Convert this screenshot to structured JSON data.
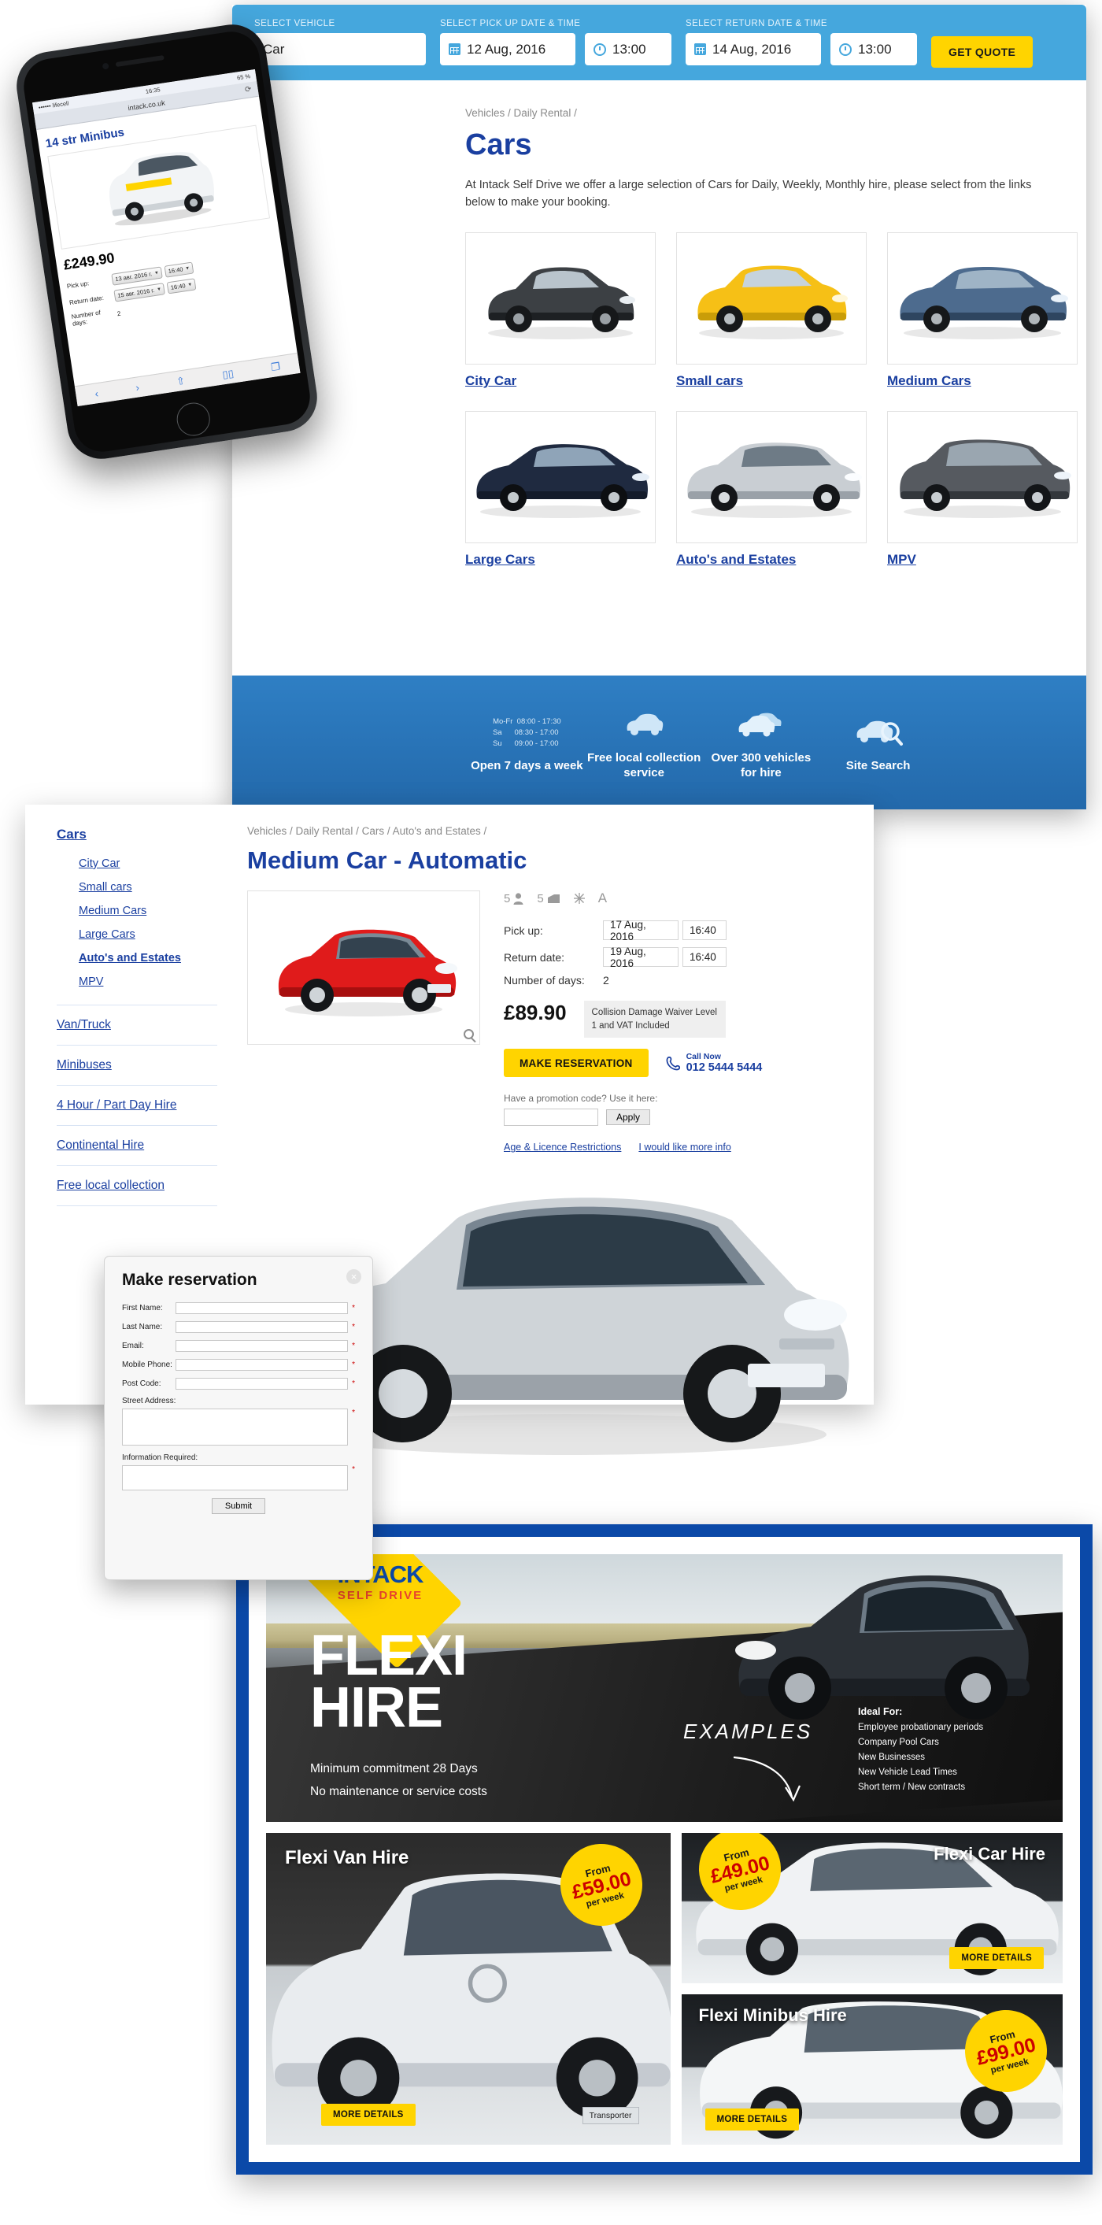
{
  "quote_bar": {
    "vehicle_label": "SELECT VEHICLE",
    "vehicle_value": "Car",
    "pickup_label": "SELECT PICK UP DATE & TIME",
    "pickup_date": "12 Aug, 2016",
    "pickup_time": "13:00",
    "return_label": "SELECT RETURN DATE & TIME",
    "return_date": "14 Aug, 2016",
    "return_time": "13:00",
    "get_quote": "GET QUOTE",
    "accent": "#45a7dd",
    "button_color": "#ffd400"
  },
  "cars_page": {
    "breadcrumb": "Vehicles / Daily Rental /",
    "title": "Cars",
    "intro": "At Intack Self Drive we offer a large selection of Cars for Daily, Weekly, Monthly hire, please select from the links below to make your booking.",
    "tiles": [
      {
        "label": "City Car"
      },
      {
        "label": "Small cars"
      },
      {
        "label": "Medium Cars"
      },
      {
        "label": "Large Cars"
      },
      {
        "label": "Auto's and Estates"
      },
      {
        "label": "MPV"
      }
    ],
    "features": [
      {
        "icon": "clock-icon",
        "title": "Open 7 days a week",
        "hours": "Mo-Fr  08:00 - 17:30\nSa      08:30 - 17:00\nSu      09:00 - 17:00"
      },
      {
        "icon": "car-collection-icon",
        "title": "Free local collection service"
      },
      {
        "icon": "cars-fleet-icon",
        "title": "Over 300 vehicles for hire"
      },
      {
        "icon": "site-search-icon",
        "title": "Site Search"
      }
    ]
  },
  "detail_page": {
    "breadcrumb": "Vehicles / Daily Rental / Cars / Auto's and Estates /",
    "title": "Medium Car - Automatic",
    "sidebar": {
      "head": "Cars",
      "sub": [
        "City Car",
        "Small cars",
        "Medium Cars",
        "Large Cars",
        "Auto's and Estates",
        "MPV"
      ],
      "active_sub": "Auto's and Estates",
      "links": [
        "Van/Truck",
        "Minibuses",
        "4 Hour / Part Day Hire",
        "Continental Hire",
        "Free local collection"
      ]
    },
    "specs": {
      "seats": "5",
      "doors": "5",
      "aircon": "aircon-icon",
      "transmission": "A"
    },
    "pickup_label": "Pick up:",
    "pickup_date": "17 Aug, 2016",
    "pickup_time": "16:40",
    "return_label": "Return date:",
    "return_date": "19 Aug, 2016",
    "return_time": "16:40",
    "days_label": "Number of days:",
    "days_value": "2",
    "price": "£89.90",
    "cdw": "Collision Damage Waiver Level 1 and VAT Included",
    "reserve_button": "MAKE RESERVATION",
    "call_now_label": "Call Now",
    "call_now_number": "012 5444 5444",
    "promo_label": "Have a promotion code? Use it here:",
    "promo_value": "",
    "apply_button": "Apply",
    "links": [
      "Age & Licence Restrictions",
      "I would like more info"
    ]
  },
  "modal": {
    "title": "Make reservation",
    "close": "×",
    "fields": [
      {
        "label": "First Name:",
        "value": "",
        "required": "*"
      },
      {
        "label": "Last Name:",
        "value": "",
        "required": "*"
      },
      {
        "label": "Email:",
        "value": "",
        "required": "*"
      },
      {
        "label": "Mobile Phone:",
        "value": "",
        "required": "*"
      },
      {
        "label": "Post Code:",
        "value": "",
        "required": "*"
      }
    ],
    "street_label": "Street Address:",
    "street_value": "",
    "info_label": "Information Required:",
    "info_value": "",
    "submit": "Submit"
  },
  "phone": {
    "carrier": "•••••• lifecell",
    "time": "16:35",
    "battery": "65 %",
    "url": "intack.co.uk",
    "title": "14 str Minibus",
    "price": "£249.90",
    "pickup_label": "Pick up:",
    "pickup_date": "13 авг. 2016 г.",
    "pickup_time": "16:40",
    "return_label": "Return date:",
    "return_date": "15 авг. 2016 г.",
    "return_time": "16:40",
    "days_label": "Number of days:",
    "days_value": "2"
  },
  "flexi": {
    "logo_top": "INTACK",
    "logo_bottom": "SELF DRIVE",
    "title_line1": "FLEXI",
    "title_line2": "HIRE",
    "sub1": "Minimum commitment 28 Days",
    "sub2": "No maintenance or service costs",
    "examples": "EXAMPLES",
    "ideal_head": "Ideal For:",
    "ideal_items": [
      "Employee probationary periods",
      "Company Pool Cars",
      "New Businesses",
      "New Vehicle Lead Times",
      "Short term / New contracts"
    ],
    "cards": [
      {
        "title": "Flexi Van Hire",
        "burst_from": "From",
        "burst_price": "£59.00",
        "burst_per": "per week",
        "more": "MORE DETAILS",
        "badge": "Transporter"
      },
      {
        "title": "Flexi Car Hire",
        "burst_from": "From",
        "burst_price": "£49.00",
        "burst_per": "per week",
        "more": "MORE DETAILS"
      },
      {
        "title": "Flexi Minibus Hire",
        "burst_from": "From",
        "burst_price": "£99.00",
        "burst_per": "per week",
        "more": "MORE DETAILS"
      }
    ]
  }
}
